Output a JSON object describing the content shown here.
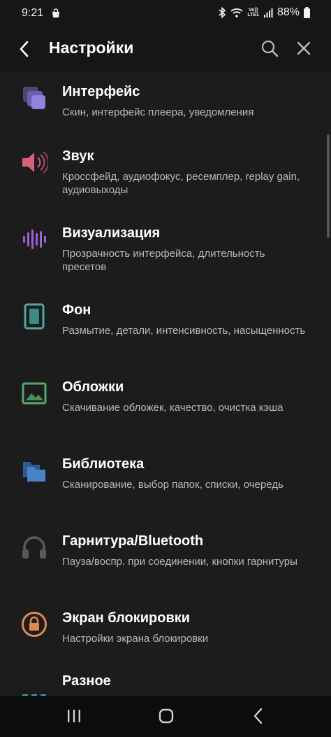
{
  "status": {
    "time": "9:21",
    "battery": "88%",
    "lte_top": "Vo))",
    "lte_bottom": "LTE1"
  },
  "header": {
    "title": "Настройки"
  },
  "items": [
    {
      "title": "Интерфейс",
      "desc": "Скин, интерфейс плеера, уведомления",
      "icon": "interface-icon",
      "color": "#8a7ad6"
    },
    {
      "title": "Звук",
      "desc": "Кроссфейд, аудиофокус, ресемплер, replay gain, аудиовыходы",
      "icon": "speaker-icon",
      "color": "#d9607a"
    },
    {
      "title": "Визуализация",
      "desc": "Прозрачность интерфейса, длительность пресетов",
      "icon": "visualization-icon",
      "color": "#9b5fd6"
    },
    {
      "title": "Фон",
      "desc": "Размытие, детали, интенсивность, насыщенность",
      "icon": "background-icon",
      "color": "#4fa7a0"
    },
    {
      "title": "Обложки",
      "desc": "Скачивание обложек, качество, очистка кэша",
      "icon": "cover-image-icon",
      "color": "#5aa56a"
    },
    {
      "title": "Библиотека",
      "desc": "Сканирование, выбор папок, списки, очередь",
      "icon": "library-folder-icon",
      "color": "#3f73b8"
    },
    {
      "title": "Гарнитура/Bluetooth",
      "desc": "Пауза/воспр. при соединении, кнопки гарнитуры",
      "icon": "headphones-icon",
      "color": "#5a5a5a"
    },
    {
      "title": "Экран блокировки",
      "desc": "Настройки экрана блокировки",
      "icon": "lock-icon",
      "color": "#e08a52"
    },
    {
      "title": "Разное",
      "desc": "",
      "icon": "misc-dots-icon",
      "color": "#3fa8b8"
    }
  ]
}
